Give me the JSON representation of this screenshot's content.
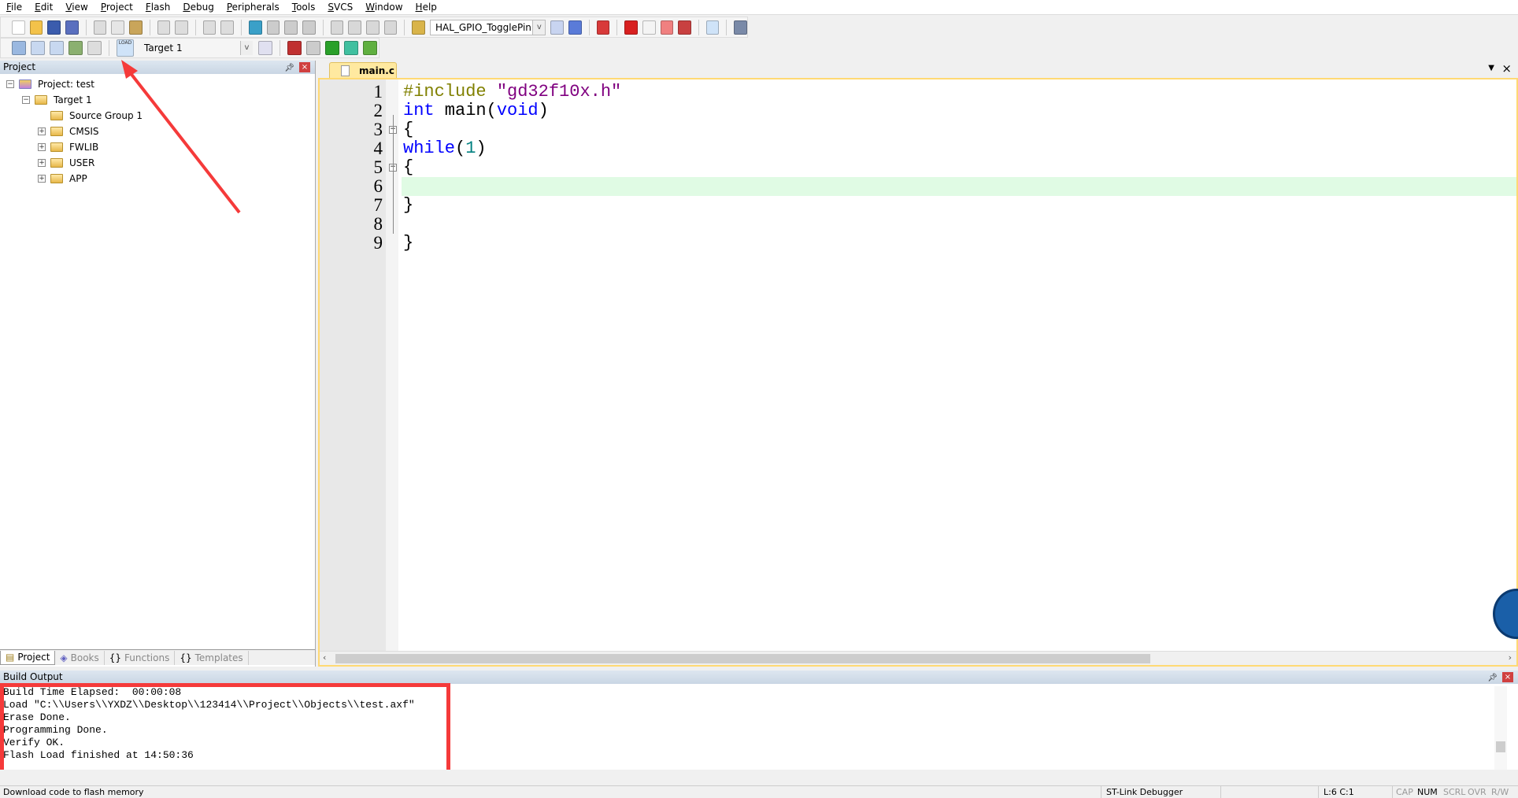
{
  "menu": [
    "File",
    "Edit",
    "View",
    "Project",
    "Flash",
    "Debug",
    "Peripherals",
    "Tools",
    "SVCS",
    "Window",
    "Help"
  ],
  "toolbar1": {
    "icons_a": [
      {
        "name": "new-file-icon",
        "color": "#ffffff"
      },
      {
        "name": "open-folder-icon",
        "color": "#f3c24a"
      },
      {
        "name": "save-icon",
        "color": "#3b5cad"
      },
      {
        "name": "save-all-icon",
        "color": "#5a6fbf"
      }
    ],
    "icons_b": [
      {
        "name": "cut-icon",
        "color": "#dddddd"
      },
      {
        "name": "copy-icon",
        "color": "#e6e6e6"
      },
      {
        "name": "paste-icon",
        "color": "#c9a55a"
      }
    ],
    "icons_c": [
      {
        "name": "undo-icon",
        "color": "#dddddd"
      },
      {
        "name": "redo-icon",
        "color": "#dddddd"
      }
    ],
    "icons_d": [
      {
        "name": "navigate-back-icon",
        "color": "#dddddd"
      },
      {
        "name": "navigate-forward-icon",
        "color": "#dddddd"
      }
    ],
    "icons_e": [
      {
        "name": "bookmark-icon",
        "color": "#3aa0c8"
      },
      {
        "name": "prev-bookmark-icon",
        "color": "#cccccc"
      },
      {
        "name": "next-bookmark-icon",
        "color": "#cccccc"
      },
      {
        "name": "clear-bookmarks-icon",
        "color": "#cccccc"
      }
    ],
    "icons_f": [
      {
        "name": "indent-icon",
        "color": "#d8d8d8"
      },
      {
        "name": "unindent-icon",
        "color": "#d8d8d8"
      },
      {
        "name": "comment-icon",
        "color": "#d8d8d8"
      },
      {
        "name": "uncomment-icon",
        "color": "#d8d8d8"
      }
    ],
    "find_combo_value": "HAL_GPIO_TogglePin",
    "icons_g": [
      {
        "name": "find-in-files-icon",
        "color": "#c8d4f0"
      },
      {
        "name": "incremental-find-icon",
        "color": "#5a7bd8"
      }
    ],
    "icons_h": [
      {
        "name": "debug-session-icon",
        "color": "#d83a3a"
      }
    ],
    "icons_i": [
      {
        "name": "breakpoint-icon",
        "color": "#d82020"
      },
      {
        "name": "disable-breakpoint-icon",
        "color": "#f4f4f4"
      },
      {
        "name": "disable-all-breakpoints-icon",
        "color": "#f08080"
      },
      {
        "name": "kill-all-breakpoints-icon",
        "color": "#c84040"
      }
    ],
    "icons_j": [
      {
        "name": "window-layout-icon",
        "color": "#cfe3f8"
      }
    ],
    "icons_k": [
      {
        "name": "configure-icon",
        "color": "#7a8aa8"
      }
    ]
  },
  "toolbar2": {
    "icons_a": [
      {
        "name": "translate-icon",
        "color": "#9ab8e0"
      },
      {
        "name": "build-icon",
        "color": "#c8d8f0"
      },
      {
        "name": "rebuild-icon",
        "color": "#c8d8f0"
      },
      {
        "name": "batch-build-icon",
        "color": "#8bb070"
      },
      {
        "name": "stop-build-icon",
        "color": "#dddddd"
      }
    ],
    "load_icon": {
      "name": "load-download-icon",
      "color": "#cfe3f8",
      "label": "LOAD"
    },
    "target_combo_value": "Target 1",
    "icons_b": [
      {
        "name": "target-options-icon",
        "color": "#e0e0f0"
      }
    ],
    "icons_c": [
      {
        "name": "manage-project-items-icon",
        "color": "#c03030"
      },
      {
        "name": "select-packs-icon",
        "color": "#cccccc"
      },
      {
        "name": "manage-run-time-environment-icon",
        "color": "#2aa02a"
      },
      {
        "name": "pack-installer-icon",
        "color": "#40c0a0"
      },
      {
        "name": "software-packs-icon",
        "color": "#60b040"
      }
    ]
  },
  "project_panel": {
    "title": "Project",
    "tree": [
      {
        "label": "Project: test",
        "level": 0,
        "toggle": "-"
      },
      {
        "label": "Target 1",
        "level": 1,
        "toggle": "-"
      },
      {
        "label": "Source Group 1",
        "level": 2,
        "toggle": ""
      },
      {
        "label": "CMSIS",
        "level": 2,
        "toggle": "+"
      },
      {
        "label": "FWLIB",
        "level": 2,
        "toggle": "+"
      },
      {
        "label": "USER",
        "level": 2,
        "toggle": "+"
      },
      {
        "label": "APP",
        "level": 2,
        "toggle": "+"
      }
    ],
    "tabs": [
      "Project",
      "Books",
      "Functions",
      "Templates"
    ]
  },
  "editor": {
    "tab": "main.c",
    "lines": [
      "#include \"gd32f10x.h\"",
      "int main(void)",
      "{",
      "while(1)",
      "{",
      "",
      "}",
      "",
      "}"
    ],
    "current_line": 6,
    "colors": {
      "preprocessor": "#808000",
      "string": "#800080",
      "keyword": "#0000ff",
      "number": "#008080",
      "current_line_bg": "#e0fbe4"
    }
  },
  "build_output": {
    "title": "Build Output",
    "lines": [
      "Build Time Elapsed:  00:00:08",
      "Load \"C:\\\\Users\\\\YXDZ\\\\Desktop\\\\123414\\\\Project\\\\Objects\\\\test.axf\"",
      "Erase Done.",
      "Programming Done.",
      "Verify OK.",
      "Flash Load finished at 14:50:36"
    ],
    "highlight_color": "#f53a3a"
  },
  "status": {
    "hint": "Download code to flash memory",
    "debugger": "ST-Link Debugger",
    "position": "L:6 C:1",
    "cap": "CAP",
    "num": "NUM",
    "scrl": "SCRL",
    "ovr": "OVR",
    "rw": "R/W"
  },
  "annotation_arrow_color": "#f53a3a"
}
